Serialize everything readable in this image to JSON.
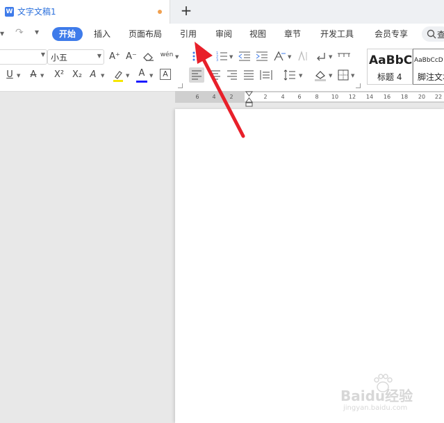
{
  "window": {
    "doc_tab_title": "文字文稿1",
    "doc_icon_letter": "W",
    "new_tab_symbol": "+"
  },
  "quick_access": {
    "undo_symbol": "↶",
    "redo_symbol": "↷",
    "more_symbol": "▾"
  },
  "menu": {
    "items": [
      "开始",
      "插入",
      "页面布局",
      "引用",
      "审阅",
      "视图",
      "章节",
      "开发工具",
      "会员专享"
    ],
    "active": "开始",
    "search_label": "查"
  },
  "toolbar": {
    "font_size": "小五",
    "font_name": "",
    "grow_font": "A⁺",
    "shrink_font": "A⁻",
    "underline": "U",
    "strikethrough": "A",
    "superscript": "X²",
    "subscript": "X₂",
    "text_effect": "A",
    "font_color": "A",
    "char_border": "A",
    "pinyin": "wén",
    "accent_colors": {
      "font_color_bar": "#1a1aff",
      "highlight_bar": "#f5e600"
    }
  },
  "styles": {
    "heading4_preview": "AaBbC",
    "heading4_label": "标题 4",
    "footnote_preview": "AaBbCcD",
    "footnote_label": "脚注文本"
  },
  "ruler": {
    "numbers": [
      "6",
      "4",
      "2",
      "2",
      "4",
      "6",
      "8",
      "10",
      "12",
      "14",
      "16",
      "18",
      "20",
      "22"
    ]
  },
  "watermark": {
    "brand": "Baidu经验",
    "url": "jingyan.baidu.com"
  },
  "colors": {
    "accent": "#3e7bea",
    "annotation_arrow": "#e8202a"
  }
}
